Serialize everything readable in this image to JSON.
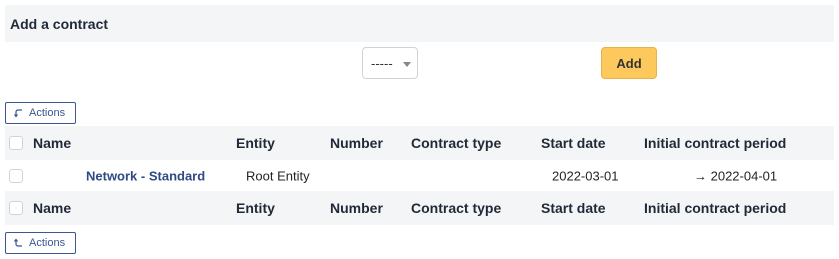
{
  "section": {
    "title": "Add a contract"
  },
  "form": {
    "select_value": "-----",
    "add_label": "Add"
  },
  "actions": {
    "label": "Actions"
  },
  "table": {
    "columns": [
      "Name",
      "Entity",
      "Number",
      "Contract type",
      "Start date",
      "Initial contract period"
    ],
    "rows": [
      {
        "name": "Network - Standard",
        "entity": "Root Entity",
        "number": "",
        "contract_type": "",
        "start_date": "2022-03-01",
        "initial_period": "→ 2022-04-01"
      }
    ]
  },
  "colors": {
    "accent": "#fec95c",
    "link": "#2f4a84",
    "header_bg": "#f4f5f7"
  },
  "icons": {
    "actions_top": "corner-arrow-down-left-icon",
    "actions_bottom": "corner-arrow-up-left-icon"
  }
}
